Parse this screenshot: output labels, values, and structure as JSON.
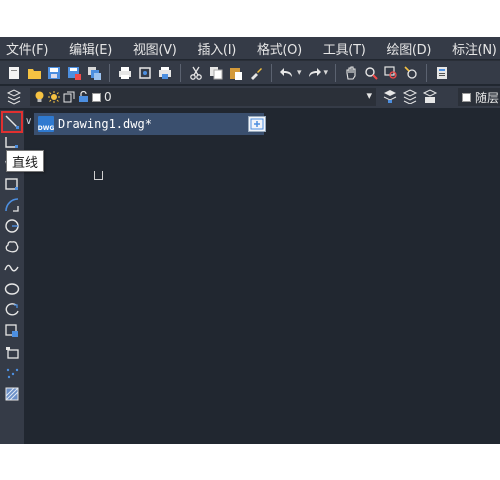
{
  "menubar": {
    "items": [
      "文件(F)",
      "编辑(E)",
      "视图(V)",
      "插入(I)",
      "格式(O)",
      "工具(T)",
      "绘图(D)",
      "标注(N)"
    ]
  },
  "toolbar1": {
    "icons": [
      "new-file-icon",
      "open-folder-icon",
      "save-icon",
      "save-as-icon",
      "batch-icon",
      "print-icon",
      "print-preview-icon",
      "plot-icon",
      "cut-icon",
      "copy-icon",
      "paste-icon",
      "match-properties-icon",
      "undo-icon",
      "redo-icon",
      "pan-icon",
      "zoom-realtime-icon",
      "zoom-window-icon",
      "zoom-previous-icon",
      "properties-icon"
    ]
  },
  "toolbar2": {
    "layer_value": "0",
    "color_label": "随层"
  },
  "tab": {
    "title": "Drawing1.dwg*",
    "file_badge": "DWG",
    "close_glyph": "✕",
    "collapse_glyph": "∨"
  },
  "tooltip": {
    "text": "直线"
  },
  "lefttoolbar": {
    "tools": [
      "line-icon",
      "polyline-icon",
      "polygon-icon",
      "rectangle-icon",
      "arc-icon",
      "circle-icon",
      "revision-cloud-icon",
      "spline-icon",
      "ellipse-icon",
      "ellipse-arc-icon",
      "insert-block-icon",
      "make-block-icon",
      "point-icon",
      "hatch-icon"
    ],
    "active": "line-icon"
  },
  "colors": {
    "canvas": "#212730",
    "chrome": "#353b47",
    "tab_active": "#3a4f6e",
    "highlight": "#e03030"
  }
}
